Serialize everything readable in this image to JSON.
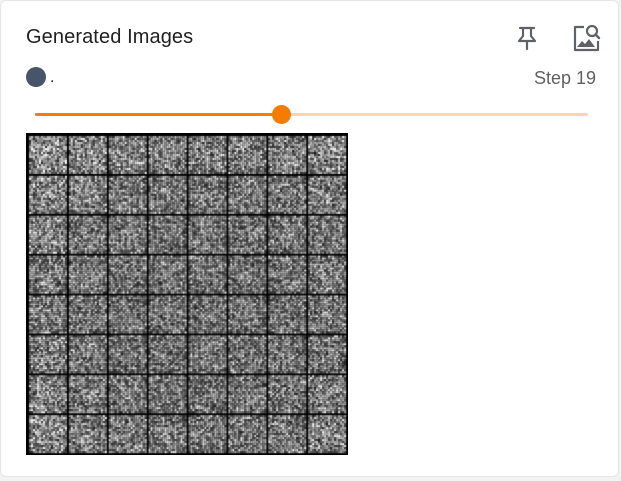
{
  "card": {
    "title": "Generated Images",
    "run_name": ".",
    "run_color": "#475569",
    "step_label": "Step 19",
    "pin_icon": "pin-icon",
    "expand_icon": "image-search-icon"
  },
  "slider": {
    "value_fraction": 0.445,
    "accent_color": "#f57c00",
    "track_color": "#fbd5b0"
  },
  "image_grid": {
    "rows": 8,
    "cols": 8,
    "description_icon": "generated-sample-grid"
  }
}
